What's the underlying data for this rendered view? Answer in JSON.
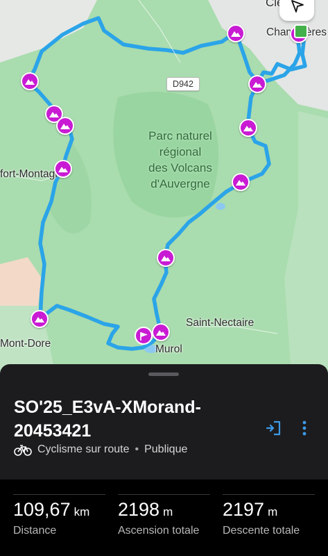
{
  "map": {
    "labels": {
      "clermont": "Cle",
      "chamalieres": "Chamalières",
      "saint_nectaire": "Saint-Nectaire",
      "murol": "Murol",
      "mont_dore": "Mont-Dore",
      "rochefort": "fort-Montagne"
    },
    "park_name_lines": [
      "Parc naturel",
      "régional",
      "des Volcans",
      "d'Auvergne"
    ],
    "road": "D942",
    "colors": {
      "route": "#2ba4e8",
      "peak_marker": "#c91bd3",
      "start_marker": "#43b149"
    },
    "icons": [
      "mountain-icon",
      "locate-arrow-icon",
      "flag-icon"
    ]
  },
  "route": {
    "title": "SO'25_E3vA-XMorand-20453421",
    "activity": "Cyclisme sur route",
    "visibility": "Publique"
  },
  "stats": [
    {
      "value": "109,67",
      "unit": "km",
      "label": "Distance"
    },
    {
      "value": "2198",
      "unit": "m",
      "label": "Ascension totale"
    },
    {
      "value": "2197",
      "unit": "m",
      "label": "Descente totale"
    }
  ],
  "colors": {
    "sheet_bg": "#1c1c1e",
    "accent": "#3d9ae8"
  }
}
